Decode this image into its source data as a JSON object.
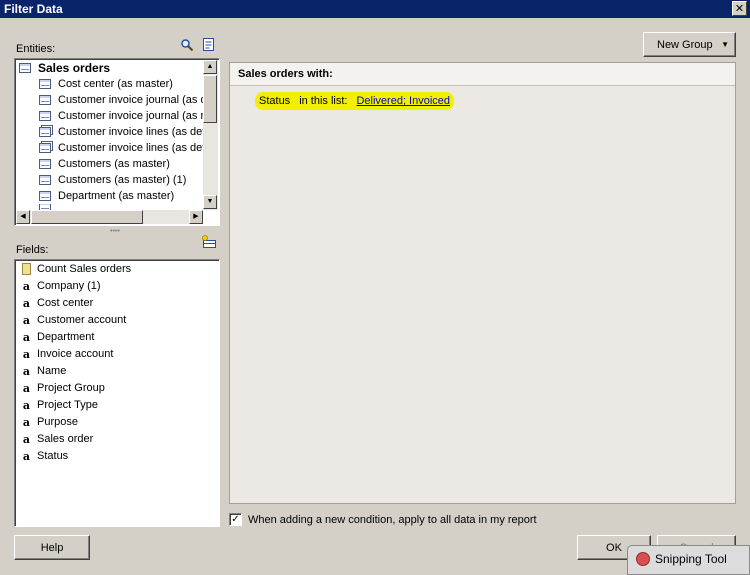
{
  "window": {
    "title": "Filter Data",
    "close_glyph": "✕"
  },
  "entities": {
    "label": "Entities:",
    "items": [
      {
        "label": "Sales orders",
        "selected": true,
        "multi": false
      },
      {
        "label": "Cost center (as master)",
        "multi": false
      },
      {
        "label": "Customer invoice journal (as d",
        "multi": false
      },
      {
        "label": "Customer invoice journal (as m",
        "multi": false
      },
      {
        "label": "Customer invoice lines (as deta",
        "multi": true
      },
      {
        "label": "Customer invoice lines (as deta",
        "multi": true
      },
      {
        "label": "Customers (as master)",
        "multi": false
      },
      {
        "label": "Customers (as master) (1)",
        "multi": false
      },
      {
        "label": "Department (as master)",
        "multi": false
      }
    ]
  },
  "fields": {
    "label": "Fields:",
    "items": [
      {
        "label": "Count Sales orders",
        "type": "count"
      },
      {
        "label": "Company (1)",
        "type": "text"
      },
      {
        "label": "Cost center",
        "type": "text"
      },
      {
        "label": "Customer account",
        "type": "text"
      },
      {
        "label": "Department",
        "type": "text"
      },
      {
        "label": "Invoice account",
        "type": "text"
      },
      {
        "label": "Name",
        "type": "text"
      },
      {
        "label": "Project Group",
        "type": "text"
      },
      {
        "label": "Project Type",
        "type": "text"
      },
      {
        "label": "Purpose",
        "type": "text"
      },
      {
        "label": "Sales order",
        "type": "text"
      },
      {
        "label": "Status",
        "type": "text"
      }
    ],
    "text_type_glyph": "a"
  },
  "new_group": {
    "label": "New Group",
    "arrow": "▼"
  },
  "filter": {
    "heading": "Sales orders with:",
    "condition": {
      "field": "Status",
      "operator": "in this list:",
      "value": "Delivered; Invoiced"
    }
  },
  "options": {
    "apply_all_label": "When adding a new condition, apply to all data in my report",
    "apply_all_checked": true,
    "check_glyph": "✓"
  },
  "buttons": {
    "help": "Help",
    "ok": "OK",
    "cancel": "Cancel"
  },
  "snipping_tool": {
    "label": "Snipping Tool"
  },
  "icons": {
    "search": "search-icon",
    "properties": "properties-icon",
    "add_field": "add-field-icon"
  },
  "colors": {
    "titlebar": "#0a246a",
    "highlight": "#f0f000",
    "link": "#0000cc"
  }
}
